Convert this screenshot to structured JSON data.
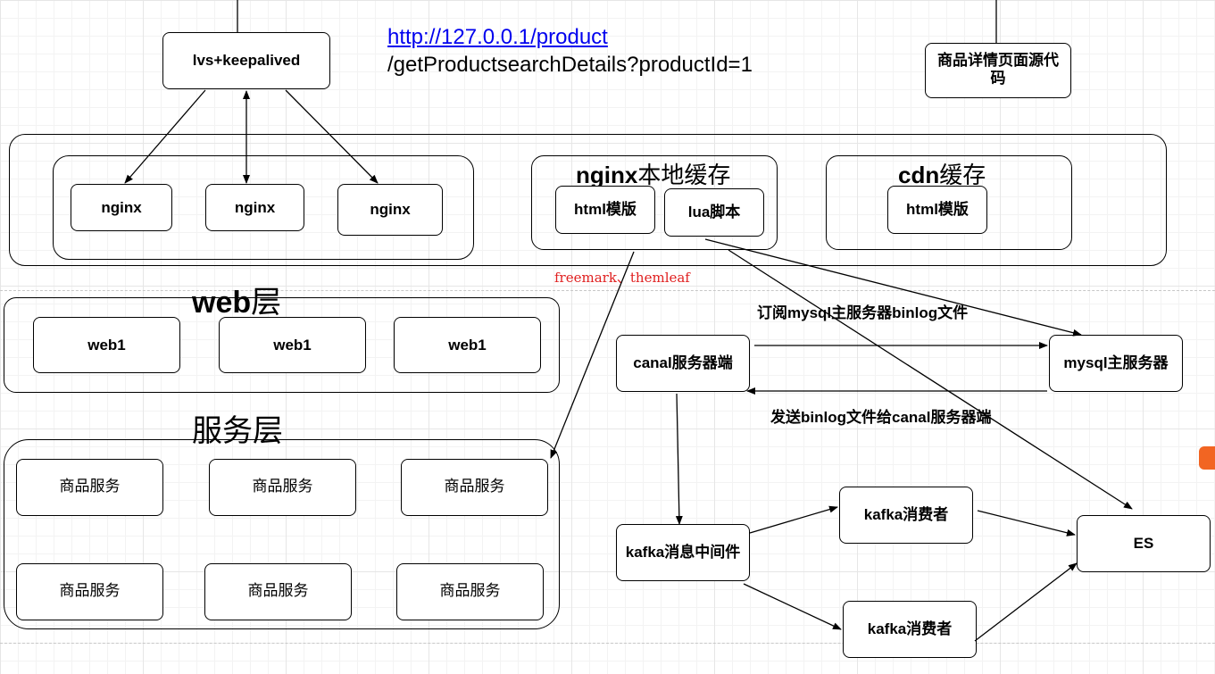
{
  "nodes": {
    "lvs": "lvs+keepalived",
    "nginx": "nginx",
    "html_tpl": "html模版",
    "lua": "lua脚本",
    "web1": "web1",
    "product_svc": "商品服务",
    "canal": "canal服务器端",
    "mysql": "mysql主服务器",
    "kafka_mq": "kafka消息中间件",
    "kafka_consumer": "kafka消费者",
    "es": "ES",
    "product_page_src": "商品详情页面源代码"
  },
  "groups": {
    "nginx_cache_title_bold": "nginx",
    "nginx_cache_title_rest": "本地缓存",
    "cdn_title_bold": "cdn",
    "cdn_title_rest": "缓存",
    "web_layer_bold": "web",
    "web_layer_rest": "层",
    "service_layer": "服务层"
  },
  "url": {
    "link": "http://127.0.0.1/product",
    "path": "/getProductsearchDetails?productId=1"
  },
  "annotations": {
    "template_engines": "freemark、themleaf",
    "subscribe": "订阅mysql主服务器binlog文件",
    "send_binlog": "发送binlog文件给canal服务器端"
  },
  "colors": {
    "link": "#0000ee",
    "annotation_red": "#e02020",
    "line": "#000000"
  }
}
